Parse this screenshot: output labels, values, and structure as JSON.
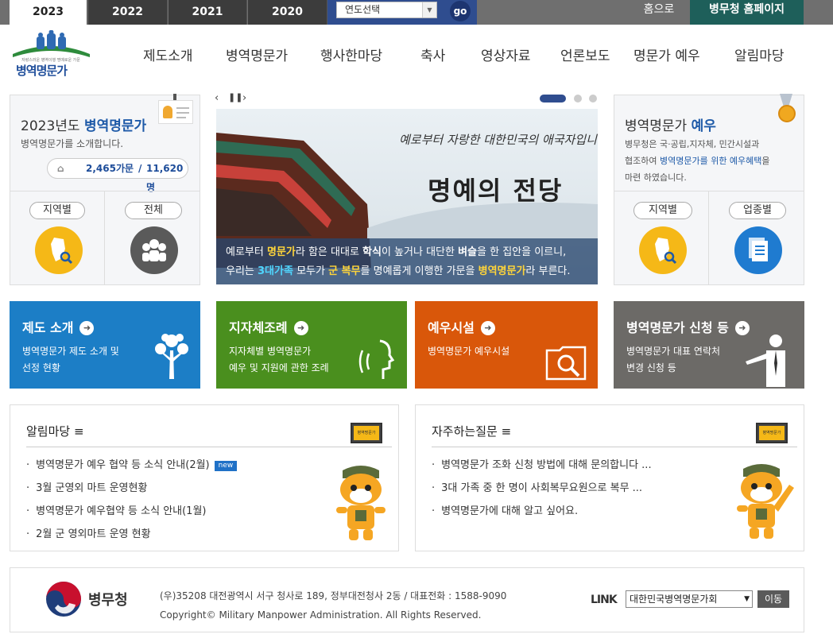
{
  "topbar": {
    "years": [
      "2023",
      "2022",
      "2021",
      "2020"
    ],
    "year_select": "연도선택",
    "go": "go",
    "home": "홈으로",
    "mma_home": "병무청 홈페이지"
  },
  "logo": {
    "text": "병역명문가",
    "tagline": "자랑스러운 병역이행 명예로운 가문"
  },
  "nav": [
    "제도소개",
    "병역명문가",
    "행사한마당",
    "축사",
    "영상자료",
    "언론보도",
    "명문가 예우",
    "알림마당"
  ],
  "left_card": {
    "title_pre": "2023년도 ",
    "title_bold": "병역명문가",
    "desc": "병역명문가를 소개합니다.",
    "families": "2,465가문",
    "people": "11,620명",
    "btn_region": "지역별",
    "btn_all": "전체"
  },
  "slide": {
    "top_script": "예로부터 자랑한 대한민국의 애국자입니다",
    "headline": "명예의 전당",
    "cap1_a": "예로부터 ",
    "cap1_b": "명문가",
    "cap1_c": "라 함은 대대로 ",
    "cap1_d": "학식",
    "cap1_e": "이 높거나 대단한 ",
    "cap1_f": "벼슬",
    "cap1_g": "을 한 집안을 이르니,",
    "cap2_a": "우리는 ",
    "cap2_b": "3대가족",
    "cap2_c": " 모두가 ",
    "cap2_d": "군 복무",
    "cap2_e": "를 명예롭게 이행한 가문을 ",
    "cap2_f": "병역명문가",
    "cap2_g": "라 부른다."
  },
  "right_card": {
    "title_pre": "병역명문가 ",
    "title_bold": "예우",
    "desc1": "병무청은 국·공립,지자체, 민간시설과",
    "desc2_a": "협조하여 ",
    "desc2_b": "병역명문가를 위한 예우혜택",
    "desc2_c": "을",
    "desc3": "마련 하였습니다.",
    "btn_region": "지역별",
    "btn_industry": "업종별"
  },
  "tiles": [
    {
      "title": "제도 소개",
      "d1": "병역명문가 제도 소개 및",
      "d2": "선정 현황",
      "color": "#1c7ec6"
    },
    {
      "title": "지자체조례",
      "d1": "지자체별 병역명문가",
      "d2": "예우 및 지원에 관한 조례",
      "color": "#4a8f1e"
    },
    {
      "title": "예우시설",
      "d1": "병역명문가 예우시설",
      "d2": "",
      "color": "#d9570a"
    },
    {
      "title": "병역명문가 신청 등",
      "d1": "병역명문가 대표 연락처",
      "d2": "변경 신청 등",
      "color": "#6c6a67"
    }
  ],
  "notice": {
    "title": "알림마당 ≡",
    "items": [
      "병역명문가 예우 협약 등 소식 안내(2월)",
      "3월 군영외 마트 운영현황",
      "병역명문가 예우협약 등 소식 안내(1월)",
      "2월 군 영외마트 운영 현황"
    ],
    "new_label": "new",
    "monitor": "병역명문가"
  },
  "faq": {
    "title": "자주하는질문 ≡",
    "items": [
      "병역명문가 조화 신청 방법에 대해 문의합니다 ...",
      "3대 가족 중 한 명이 사회복무요원으로 복무 ...",
      "병역명문가에 대해 알고 싶어요."
    ],
    "monitor": "병역명문가"
  },
  "footer": {
    "org": "병무청",
    "address": "(우)35208 대전광역시 서구 청사로 189, 정부대전청사 2동 / 대표전화 : 1588-9090",
    "copyright": "Copyright© Military Manpower Administration. All Rights Reserved.",
    "link_label": "LINK",
    "link_select": "대한민국병역명문가회",
    "go": "이동"
  }
}
